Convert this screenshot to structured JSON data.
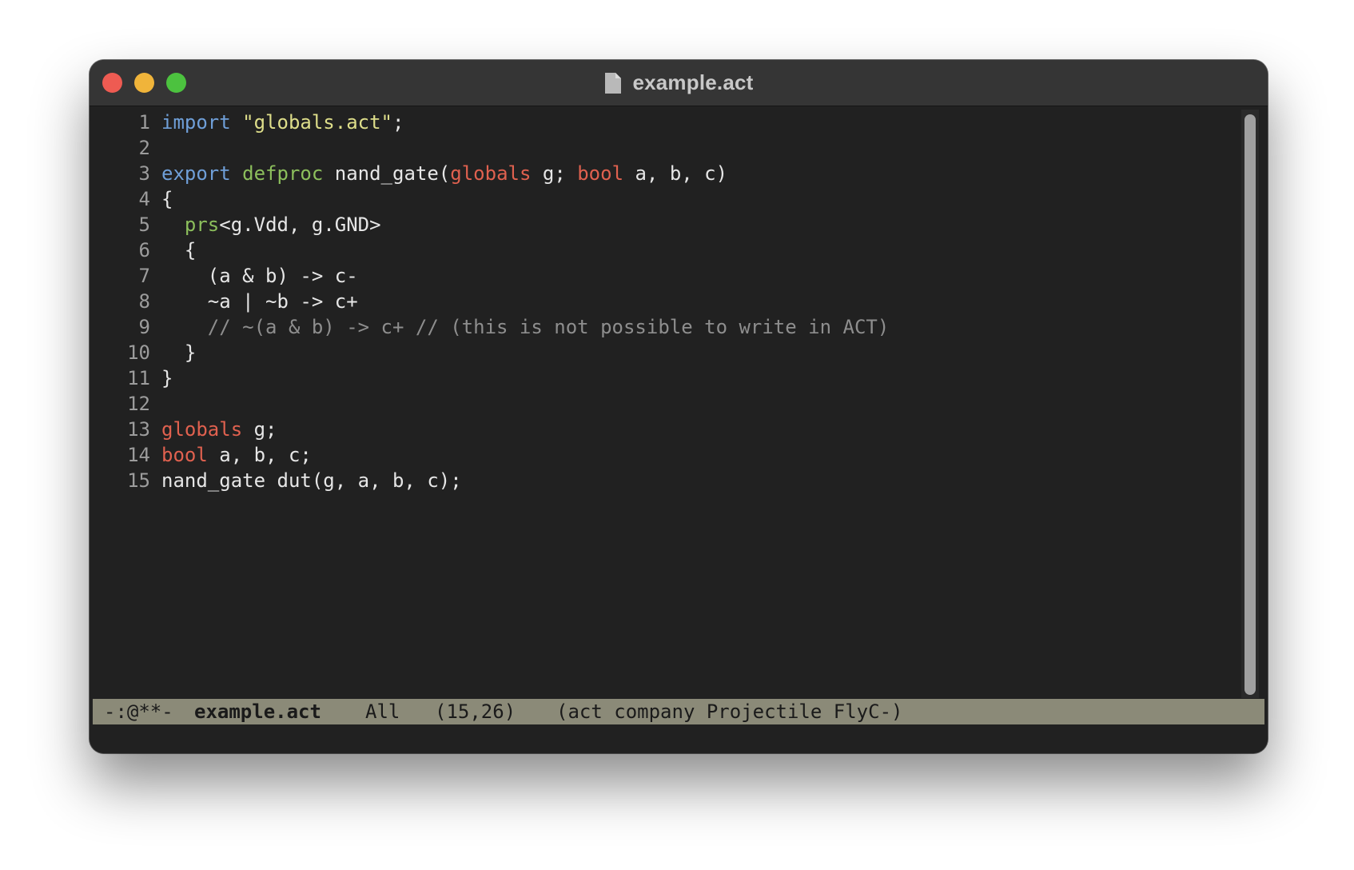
{
  "window": {
    "title": "example.act",
    "buttons": {
      "close": "close",
      "minimize": "minimize",
      "zoom": "zoom"
    },
    "title_icon": "document-icon"
  },
  "editor": {
    "lines": [
      {
        "number": "1",
        "tokens": [
          {
            "t": "import",
            "c": "kw-blue"
          },
          {
            "t": " ",
            "c": "plain"
          },
          {
            "t": "\"globals.act\"",
            "c": "str"
          },
          {
            "t": ";",
            "c": "plain"
          }
        ]
      },
      {
        "number": "2",
        "tokens": []
      },
      {
        "number": "3",
        "tokens": [
          {
            "t": "export",
            "c": "kw-blue"
          },
          {
            "t": " ",
            "c": "plain"
          },
          {
            "t": "defproc",
            "c": "kw-green"
          },
          {
            "t": " nand_gate(",
            "c": "plain"
          },
          {
            "t": "globals",
            "c": "kw-red"
          },
          {
            "t": " g; ",
            "c": "plain"
          },
          {
            "t": "bool",
            "c": "kw-red"
          },
          {
            "t": " a, b, c)",
            "c": "plain"
          }
        ]
      },
      {
        "number": "4",
        "tokens": [
          {
            "t": "{",
            "c": "plain"
          }
        ]
      },
      {
        "number": "5",
        "tokens": [
          {
            "t": "  ",
            "c": "plain"
          },
          {
            "t": "prs",
            "c": "kw-green"
          },
          {
            "t": "<g.Vdd, g.GND>",
            "c": "plain"
          }
        ]
      },
      {
        "number": "6",
        "tokens": [
          {
            "t": "  {",
            "c": "plain"
          }
        ]
      },
      {
        "number": "7",
        "tokens": [
          {
            "t": "    (a & b) -> c-",
            "c": "plain"
          }
        ]
      },
      {
        "number": "8",
        "tokens": [
          {
            "t": "    ~a | ~b -> c+",
            "c": "plain"
          }
        ]
      },
      {
        "number": "9",
        "tokens": [
          {
            "t": "    ",
            "c": "plain"
          },
          {
            "t": "// ~(a & b) -> c+ // (this is not possible to write in ACT)",
            "c": "cmt"
          }
        ]
      },
      {
        "number": "10",
        "tokens": [
          {
            "t": "  }",
            "c": "plain"
          }
        ]
      },
      {
        "number": "11",
        "tokens": [
          {
            "t": "}",
            "c": "plain"
          }
        ]
      },
      {
        "number": "12",
        "tokens": []
      },
      {
        "number": "13",
        "tokens": [
          {
            "t": "globals",
            "c": "kw-red"
          },
          {
            "t": " g;",
            "c": "plain"
          }
        ]
      },
      {
        "number": "14",
        "tokens": [
          {
            "t": "bool",
            "c": "kw-red"
          },
          {
            "t": " a, b, c;",
            "c": "plain"
          }
        ]
      },
      {
        "number": "15",
        "tokens": [
          {
            "t": "nand_gate dut(g, a, b, c);",
            "c": "plain"
          }
        ]
      }
    ]
  },
  "modeline": {
    "status": "-:@**-",
    "buffer": "example.act",
    "position": "All",
    "line_col": "(15,26)",
    "modes": "(act company Projectile FlyC-)"
  },
  "colors": {
    "keyword_blue": "#6f9fd8",
    "keyword_green": "#8cbf5c",
    "keyword_red": "#e0614f",
    "string": "#dede8a",
    "comment": "#8e8e8e",
    "background": "#212121",
    "modeline_bg": "#8b8a78"
  }
}
